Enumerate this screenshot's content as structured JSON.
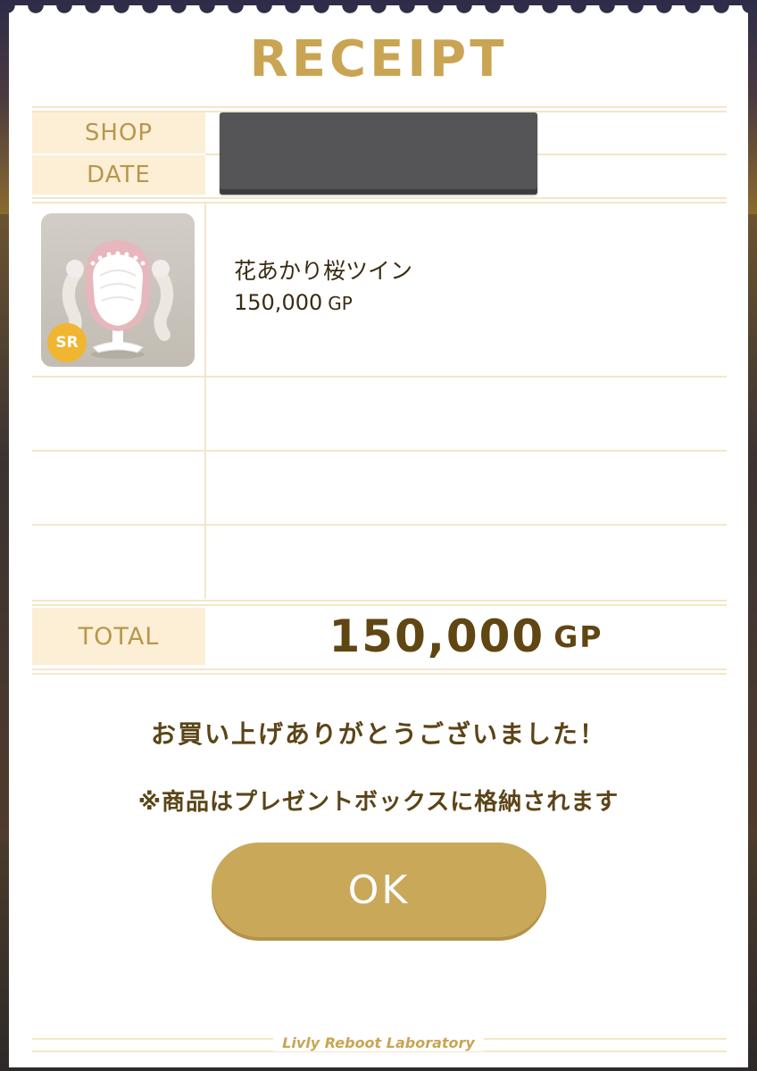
{
  "receipt": {
    "title": "RECEIPT",
    "shop_label": "SHOP",
    "date_label": "DATE",
    "items": [
      {
        "name": "花あかり桜ツイン",
        "price": "150,000",
        "unit": "GP",
        "rarity": "SR"
      }
    ],
    "total_label": "TOTAL",
    "total_value": "150,000",
    "total_unit": "GP",
    "thanks_message": "お買い上げありがとうございました！",
    "note": "※商品はプレゼントボックスに格納されます",
    "ok_label": "OK",
    "footer": "Livly Reboot Laboratory"
  },
  "colors": {
    "accent_gold": "#c9a553",
    "label_bg": "#fcefd6",
    "line": "#f5e6c8",
    "text_dark": "#5b4416",
    "button": "#c9a85a",
    "rarity_badge": "#f0b531",
    "redaction": "#555558"
  }
}
